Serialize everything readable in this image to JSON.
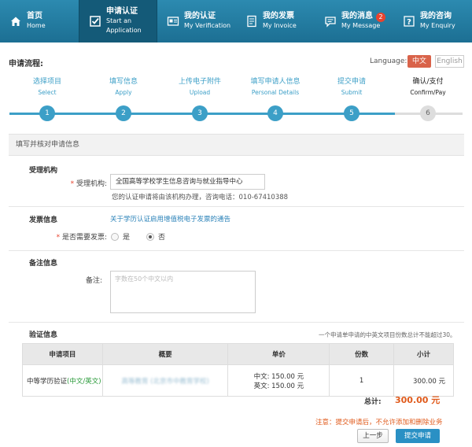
{
  "nav": {
    "items": [
      {
        "cn": "首页",
        "en": "Home",
        "icon": "home-icon"
      },
      {
        "cn": "申请认证",
        "en": "Start an Application",
        "icon": "checkbox-icon"
      },
      {
        "cn": "我的认证",
        "en": "My Verification",
        "icon": "certificate-icon"
      },
      {
        "cn": "我的发票",
        "en": "My Invoice",
        "icon": "invoice-icon"
      },
      {
        "cn": "我的消息",
        "en": "My Message",
        "icon": "message-icon"
      },
      {
        "cn": "我的咨询",
        "en": "My Enquiry",
        "icon": "question-icon"
      }
    ],
    "message_badge": "2",
    "active_index": 1,
    "colors": {
      "bar": "#2c8ab0",
      "active": "#145a78"
    }
  },
  "header": {
    "title": "申请流程:",
    "language_label": "Language:",
    "lang_zh": "中文",
    "lang_en": "English"
  },
  "steps": [
    {
      "cn": "选择项目",
      "en": "Select",
      "num": "1"
    },
    {
      "cn": "填写信息",
      "en": "Apply",
      "num": "2"
    },
    {
      "cn": "上传电子附件",
      "en": "Upload",
      "num": "3"
    },
    {
      "cn": "填写申请人信息",
      "en": "Personal Details",
      "num": "4"
    },
    {
      "cn": "提交申请",
      "en": "Submit",
      "num": "5"
    },
    {
      "cn": "确认/支付",
      "en": "Confirm/Pay",
      "num": "6"
    }
  ],
  "form": {
    "panel_title": "填写并核对申请信息",
    "agency": {
      "section": "受理机构",
      "label": "受理机构:",
      "value": "全国高等学校学生信息咨询与就业指导中心",
      "hint": "您的认证申请将由该机构办理，咨询电话：010-67410388"
    },
    "invoice": {
      "section": "发票信息",
      "link": "关于学历认证启用增值税电子发票的通告",
      "label": "是否需要发票:",
      "opt_yes": "是",
      "opt_no": "否",
      "selected": "否"
    },
    "remark": {
      "section": "备注信息",
      "label": "备注:",
      "placeholder": "字数在50个中文以内"
    },
    "verify": {
      "section": "验证信息",
      "note": "一个申请单申请的中英文项目份数总计不能超过30。"
    }
  },
  "table": {
    "headers": [
      "申请项目",
      "概要",
      "单价",
      "份数",
      "小计"
    ],
    "row": {
      "item": "中等学历验证",
      "item_sub": "(中文/英文)",
      "summary": "高等教育 (北京市中教育学校)",
      "price_zh": "中文: 150.00 元",
      "price_en": "英文: 150.00 元",
      "qty": "1",
      "subtotal": "300.00 元"
    }
  },
  "footer": {
    "total_label": "总计:",
    "total_value": "300.00 元",
    "notice": "注意：提交申请后，不允许添加和删除业务",
    "prev_label": "上一步",
    "submit_label": "提交申请"
  }
}
